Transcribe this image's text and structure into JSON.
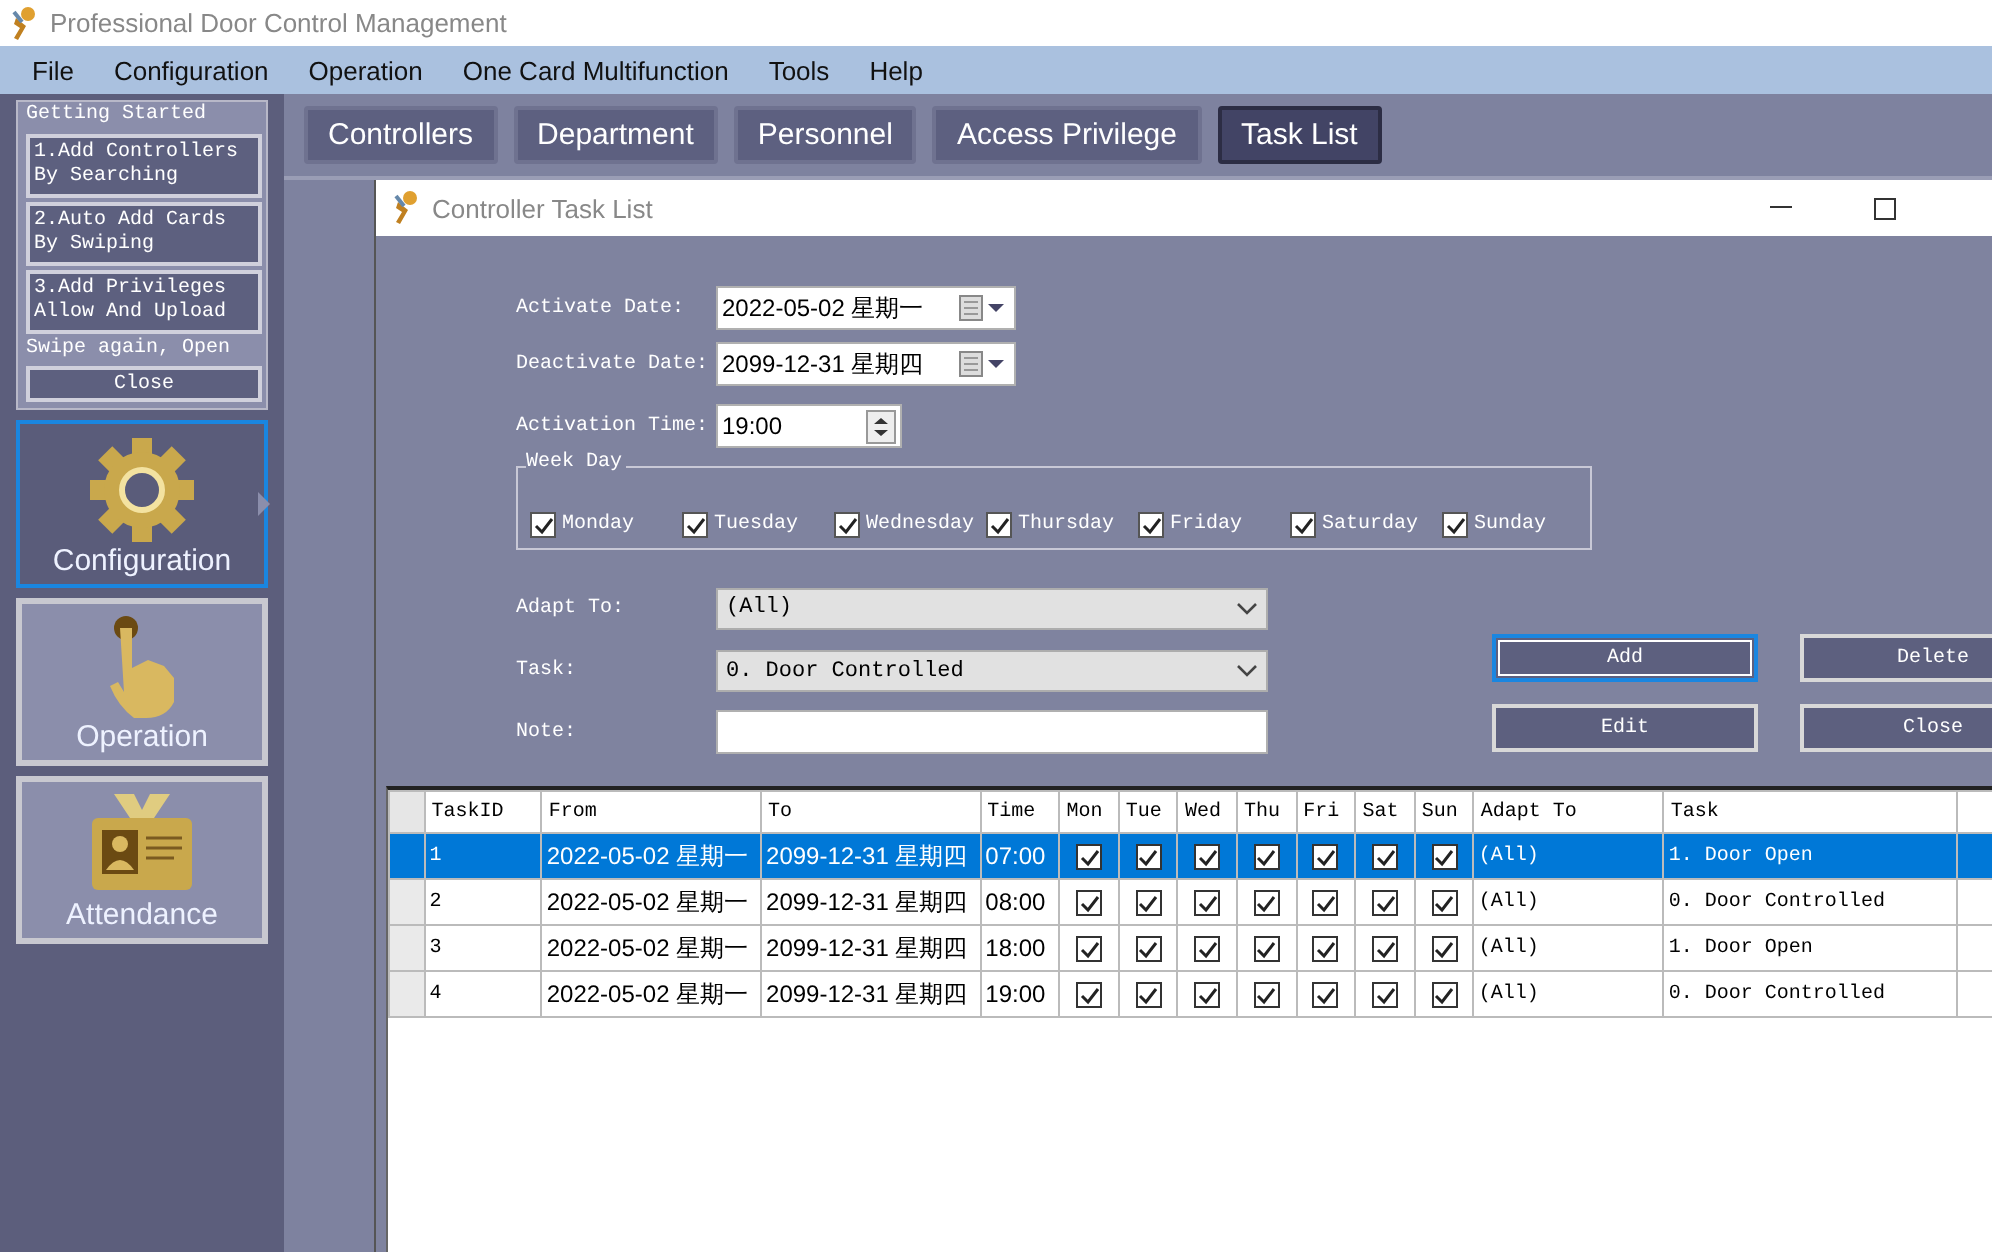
{
  "window": {
    "title": "Professional Door Control Management"
  },
  "menu": [
    "File",
    "Configuration",
    "Operation",
    "One Card Multifunction",
    "Tools",
    "Help"
  ],
  "getting_started": {
    "title": "Getting Started",
    "steps": [
      "1.Add Controllers By Searching",
      "2.Auto Add Cards By Swiping",
      "3.Add Privileges Allow And Upload"
    ],
    "note": "Swipe again, Open",
    "close": "Close"
  },
  "nav": [
    {
      "kind": "gear",
      "label": "Configuration",
      "selected": true
    },
    {
      "kind": "hand",
      "label": "Operation",
      "selected": false
    },
    {
      "kind": "card",
      "label": "Attendance",
      "selected": false
    }
  ],
  "tabs": [
    {
      "label": "Controllers",
      "selected": false
    },
    {
      "label": "Department",
      "selected": false
    },
    {
      "label": "Personnel",
      "selected": false
    },
    {
      "label": "Access Privilege",
      "selected": false
    },
    {
      "label": "Task List",
      "selected": true
    }
  ],
  "dialog": {
    "title": "Controller Task List",
    "activate_date": {
      "label": "Activate Date:",
      "value": "2022-05-02 星期一"
    },
    "deactivate_date": {
      "label": "Deactivate Date:",
      "value": "2099-12-31 星期四"
    },
    "activation_time": {
      "label": "Activation Time:",
      "value": "19:00"
    },
    "week_day": {
      "title": "Week Day",
      "days": [
        {
          "label": "Monday",
          "checked": true
        },
        {
          "label": "Tuesday",
          "checked": true
        },
        {
          "label": "Wednesday",
          "checked": true
        },
        {
          "label": "Thursday",
          "checked": true
        },
        {
          "label": "Friday",
          "checked": true
        },
        {
          "label": "Saturday",
          "checked": true
        },
        {
          "label": "Sunday",
          "checked": true
        }
      ]
    },
    "adapt_to": {
      "label": "Adapt To:",
      "value": "(All)"
    },
    "task": {
      "label": "Task:",
      "value": "0. Door Controlled"
    },
    "note": {
      "label": "Note:"
    },
    "buttons": [
      {
        "label": "Add",
        "selected": true
      },
      {
        "label": "Delete",
        "selected": false
      },
      {
        "label": "Edit",
        "selected": false
      },
      {
        "label": "Close",
        "selected": false
      }
    ]
  },
  "table": {
    "columns": [
      "TaskID",
      "From",
      "To",
      "Time",
      "Mon",
      "Tue",
      "Wed",
      "Thu",
      "Fri",
      "Sat",
      "Sun",
      "Adapt To",
      "Task"
    ],
    "rows": [
      {
        "selected": true,
        "task_id": "1",
        "from": "2022-05-02 星期一",
        "to": "2099-12-31 星期四",
        "time": "07:00",
        "days": [
          true,
          true,
          true,
          true,
          true,
          true,
          true
        ],
        "adapt_to": "(All)",
        "task": "1. Door Open"
      },
      {
        "selected": false,
        "task_id": "2",
        "from": "2022-05-02 星期一",
        "to": "2099-12-31 星期四",
        "time": "08:00",
        "days": [
          true,
          true,
          true,
          true,
          true,
          true,
          true
        ],
        "adapt_to": "(All)",
        "task": "0. Door Controlled"
      },
      {
        "selected": false,
        "task_id": "3",
        "from": "2022-05-02 星期一",
        "to": "2099-12-31 星期四",
        "time": "18:00",
        "days": [
          true,
          true,
          true,
          true,
          true,
          true,
          true
        ],
        "adapt_to": "(All)",
        "task": "1. Door Open"
      },
      {
        "selected": false,
        "task_id": "4",
        "from": "2022-05-02 星期一",
        "to": "2099-12-31 星期四",
        "time": "19:00",
        "days": [
          true,
          true,
          true,
          true,
          true,
          true,
          true
        ],
        "adapt_to": "(All)",
        "task": "0. Door Controlled"
      }
    ]
  }
}
